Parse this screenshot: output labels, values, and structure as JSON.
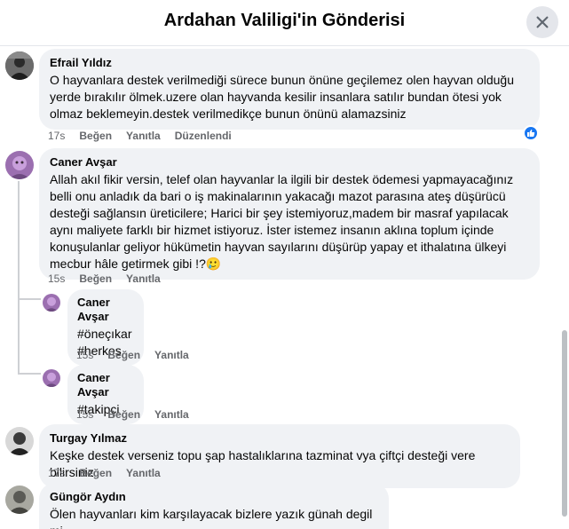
{
  "header": {
    "title": "Ardahan Valiligi'in Gönderisi"
  },
  "comments": [
    {
      "author": "Efrail Yıldız",
      "text": "O hayvanlara destek verilmediği sürece bunun önüne geçilemez olen hayvan olduğu yerde bırakılır ölmek.uzere olan hayvanda kesilir insanlara satılır bundan ötesi yok olmaz beklemeyin.destek verilmedikçe bunun önünü alamazsiniz",
      "time": "17s",
      "like": "Beğen",
      "reply": "Yanıtla",
      "edit": "Düzenlendi",
      "reaction": "like-reaction-icon"
    },
    {
      "author": "Caner Avşar",
      "text": "Allah akıl fikir versin, telef olan hayvanlar la ilgili bir destek ödemesi yapmayacağınız belli onu anladık da bari o iş makinalarının yakacağı mazot parasına ateş düşürücü desteği sağlansın üreticilere; Harici bir şey istemiyoruz,madem bir masraf yapılacak aynı maliyete farklı bir hizmet istiyoruz. İster istemez insanın aklına toplum içinde konuşulanlar geliyor hükümetin hayvan sayılarını düşürüp yapay et ithalatına ülkeyi mecbur hâle getirmek gibi !?",
      "emoji": "🥲",
      "time": "15s",
      "like": "Beğen",
      "reply": "Yanıtla"
    },
    {
      "author": "Turgay Yılmaz",
      "text": "Keşke destek verseniz topu şap hastalıklarına tazminat vya çiftçi desteği vere bilirsiniz",
      "time": "17s",
      "like": "Beğen",
      "reply": "Yanıtla"
    },
    {
      "author": "Güngör Aydın",
      "text": "Ölen hayvanları kim karşılayacak bizlere yazık günah degil mi"
    }
  ],
  "replies": [
    {
      "author": "Caner Avşar",
      "lines": [
        "#öneçıkar",
        "#herkes"
      ],
      "time": "15s",
      "like": "Beğen",
      "reply": "Yanıtla"
    },
    {
      "author": "Caner Avşar",
      "lines": [
        "#takipçi"
      ],
      "time": "15s",
      "like": "Beğen",
      "reply": "Yanıtla"
    }
  ]
}
